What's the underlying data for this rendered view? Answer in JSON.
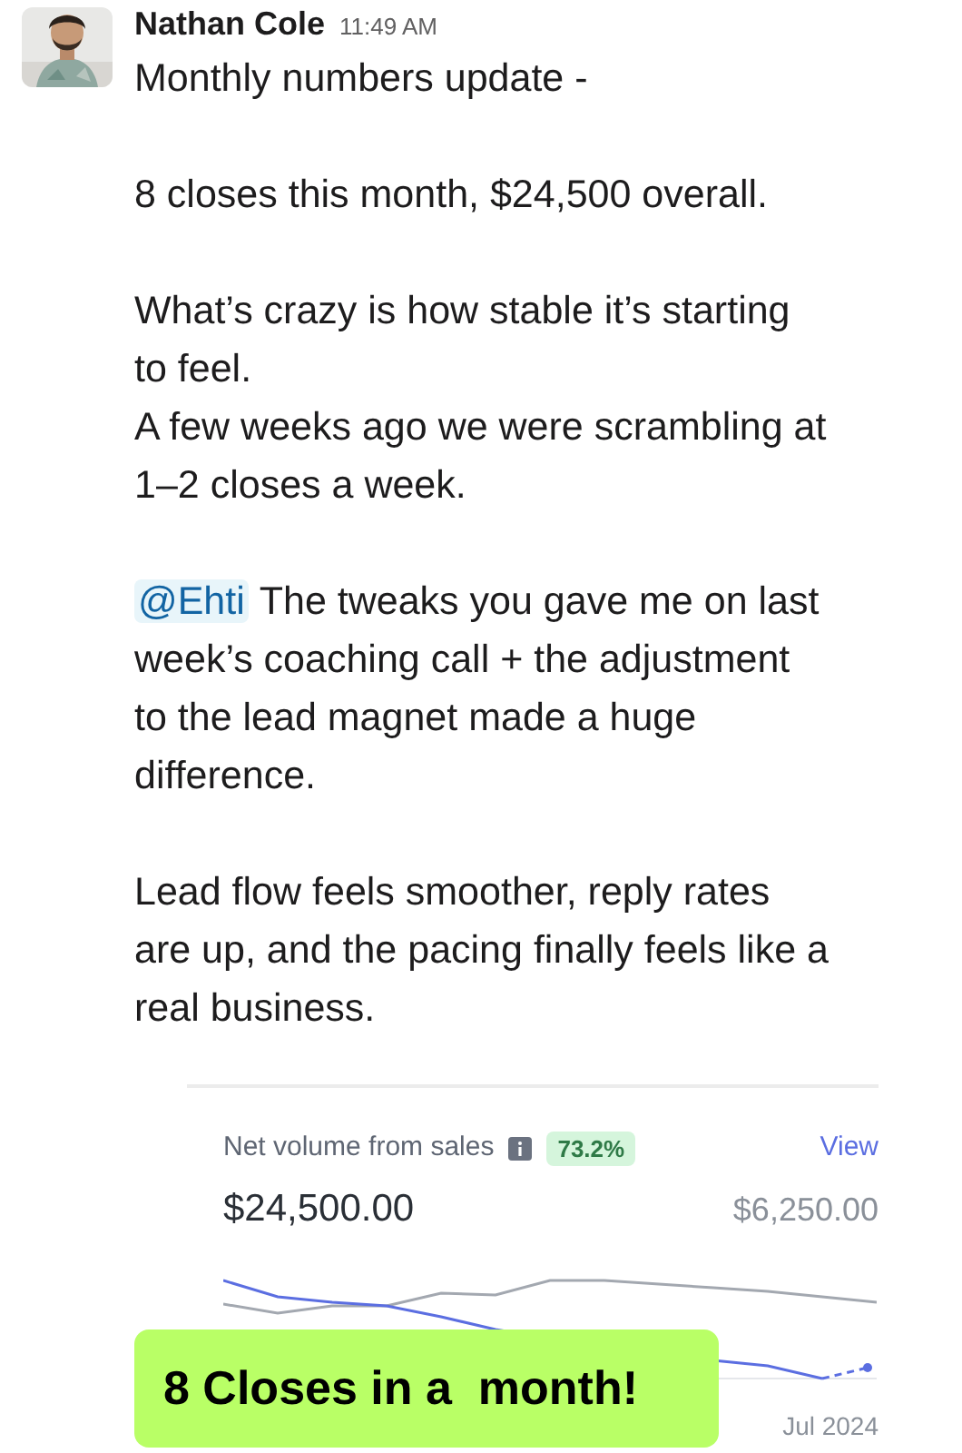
{
  "message": {
    "author": "Nathan Cole",
    "time": "11:49 AM",
    "paragraphs": [
      {
        "lines": [
          "Monthly numbers update -"
        ]
      },
      {
        "lines": [
          "8 closes this month, $24,500 overall."
        ]
      },
      {
        "lines": [
          "What’s crazy is how stable it’s starting to feel.",
          "A few weeks ago we were scrambling at 1–2 closes a week."
        ]
      },
      {
        "mention": "@Ehti",
        "lines": [
          "The tweaks you gave me on last week’s coaching call + the adjustment to the lead magnet made a huge difference."
        ]
      },
      {
        "lines": [
          "Lead flow feels smoother, reply rates are up, and the pacing finally feels like a real business."
        ]
      }
    ]
  },
  "card": {
    "title": "Net volume from sales",
    "badge": "73.2%",
    "link": "View",
    "value": "$24,500.00",
    "previous": "$6,250.00",
    "axis_label": "Jul 2024"
  },
  "overlay": {
    "text": "8 Closes in a  month!"
  }
}
